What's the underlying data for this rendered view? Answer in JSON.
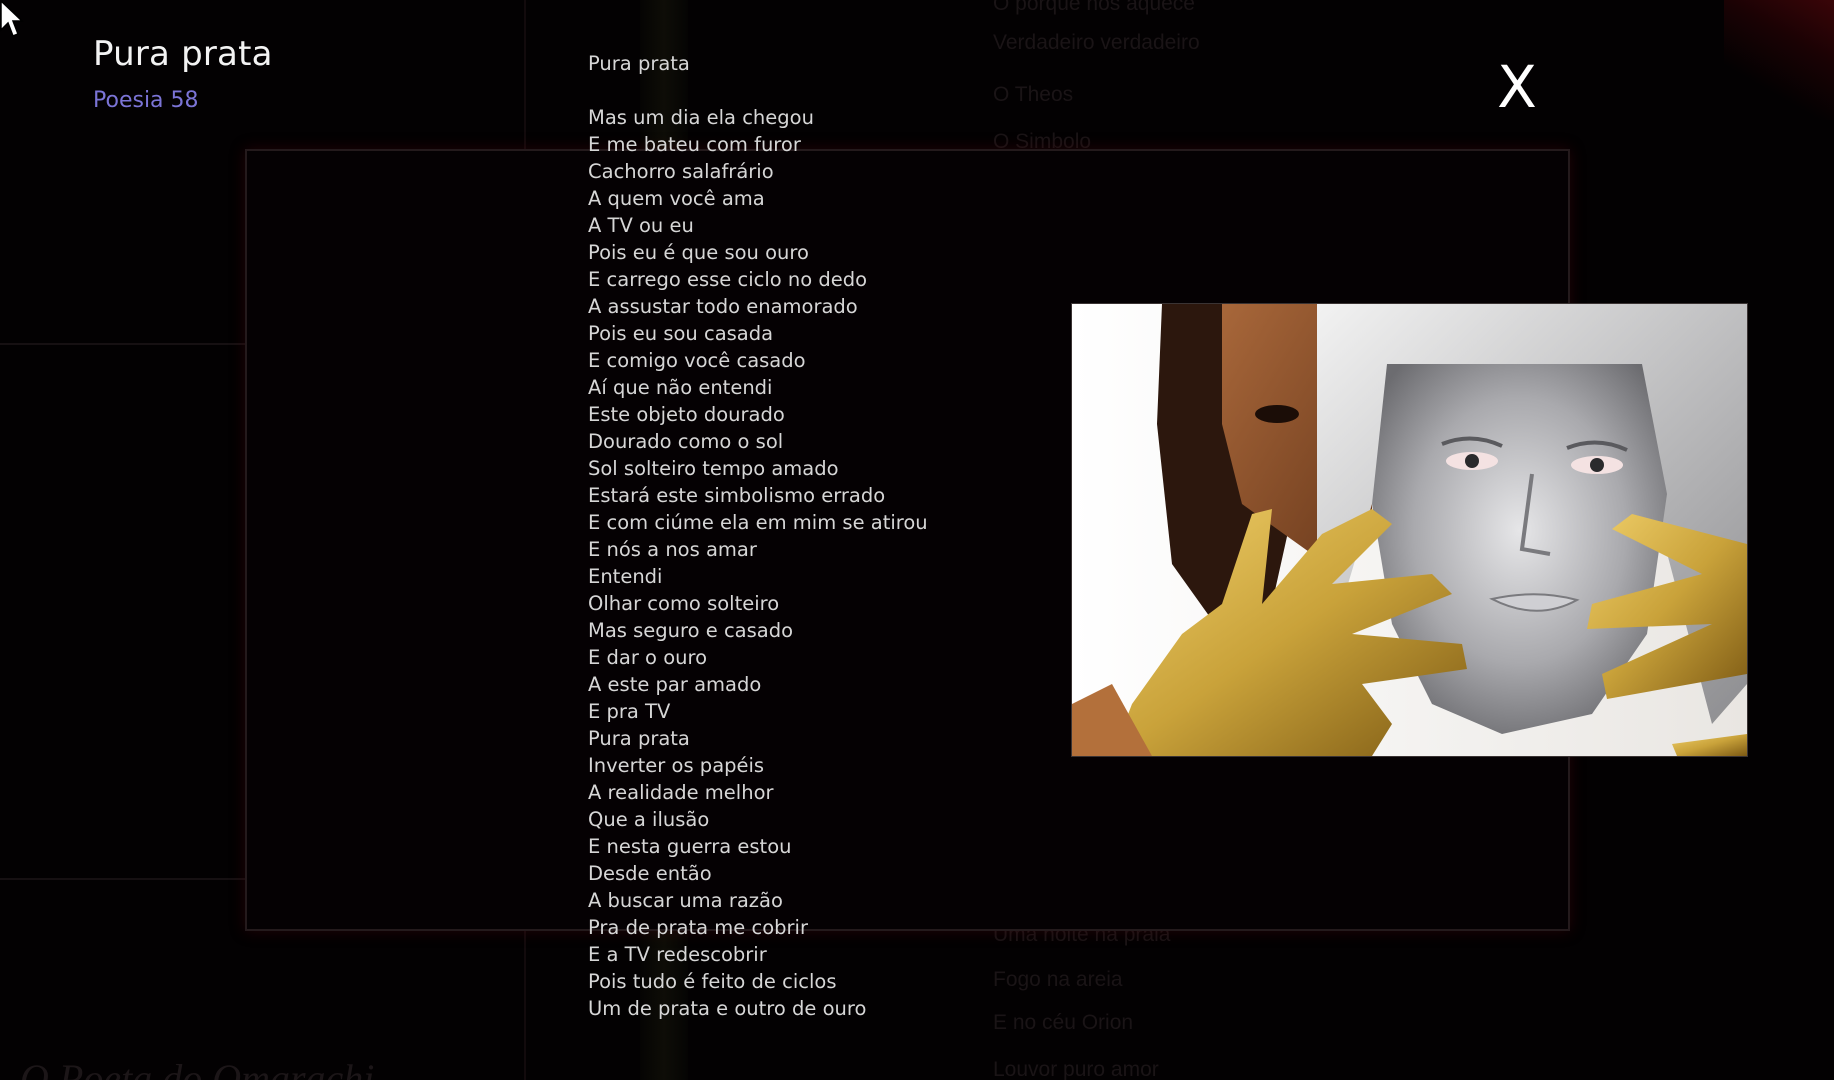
{
  "header": {
    "title": "Pura prata",
    "subtitle": "Poesia 58"
  },
  "poem": {
    "title": "Pura prata",
    "lines": [
      "Mas um dia ela chegou",
      "E me bateu com furor",
      "Cachorro salafrário",
      "A quem você ama",
      "A TV ou eu",
      "Pois eu é que sou ouro",
      "E carrego esse ciclo no dedo",
      "A assustar todo enamorado",
      "Pois eu sou casada",
      "E comigo você casado",
      "Aí que não entendi",
      "Este objeto dourado",
      "Dourado como o sol",
      "Sol solteiro tempo amado",
      "Estará este simbolismo errado",
      "E com ciúme ela em mim se atirou",
      "E nós a nos amar",
      "Entendi",
      "Olhar como solteiro",
      "Mas seguro e casado",
      "E dar o ouro",
      "A este par amado",
      "E pra TV",
      "Pura prata",
      "Inverter os papéis",
      "A realidade melhor",
      "Que a ilusão",
      "E nesta guerra estou",
      "Desde então",
      "A buscar uma razão",
      "Pra de prata me cobrir",
      "E a TV redescobrir",
      "Pois tudo é feito de ciclos",
      "Um de prata e outro de ouro"
    ]
  },
  "close": {
    "label": "X"
  },
  "background": {
    "items_top": [
      "O porque nos aquece",
      "Verdadeiro  verdadeiro",
      "O Theos",
      "O Simbolo"
    ],
    "items_bottom": [
      "Uma noite na praia",
      "Fogo na areia",
      "E no céu Orion",
      "Louvor puro amor"
    ],
    "watermark": "O Poeta do Omarachi"
  },
  "photo": {
    "icon": "poem-illustration-image",
    "silver_color": "#b9b9bb",
    "gold_color": "#c9a23a"
  },
  "colors": {
    "background": "#030102",
    "text": "#d6d6d6",
    "accent": "#7b74d6",
    "panel_border": "#241a1c"
  }
}
